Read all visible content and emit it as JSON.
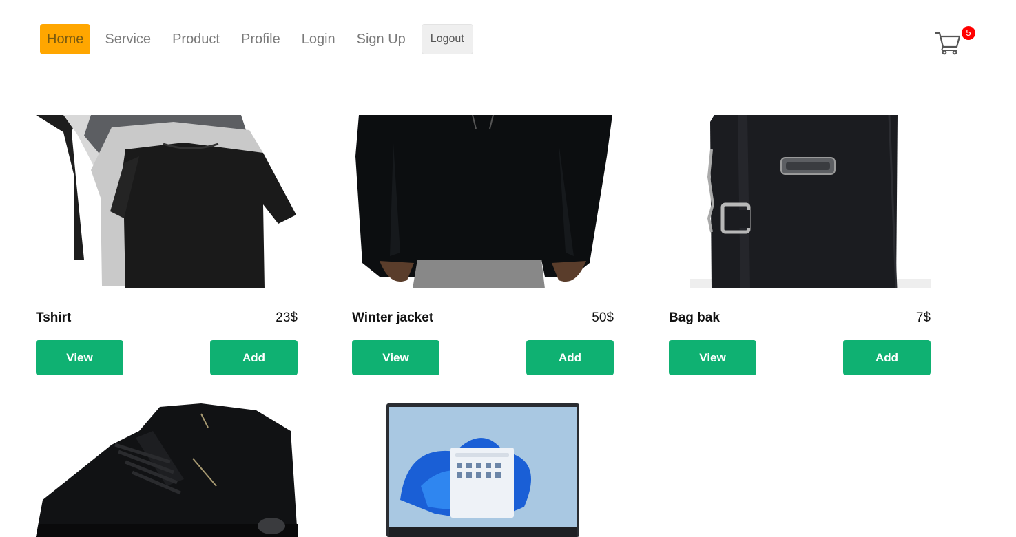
{
  "nav": {
    "items": [
      {
        "label": "Home",
        "active": true
      },
      {
        "label": "Service"
      },
      {
        "label": "Product"
      },
      {
        "label": "Profile"
      },
      {
        "label": "Login"
      },
      {
        "label": "Sign Up"
      }
    ],
    "logout_label": "Logout",
    "cart_count": "5",
    "accent_color": "#ffa600"
  },
  "products": [
    {
      "name": "Tshirt",
      "price": "23$",
      "view_label": "View",
      "add_label": "Add",
      "image": "tshirt-stack"
    },
    {
      "name": "Winter jacket",
      "price": "50$",
      "view_label": "View",
      "add_label": "Add",
      "image": "black-hoodie"
    },
    {
      "name": "Bag bak",
      "price": "7$",
      "view_label": "View",
      "add_label": "Add",
      "image": "black-bag"
    },
    {
      "image": "black-sneaker"
    },
    {
      "image": "laptop"
    }
  ],
  "button_color": "#0fb172"
}
